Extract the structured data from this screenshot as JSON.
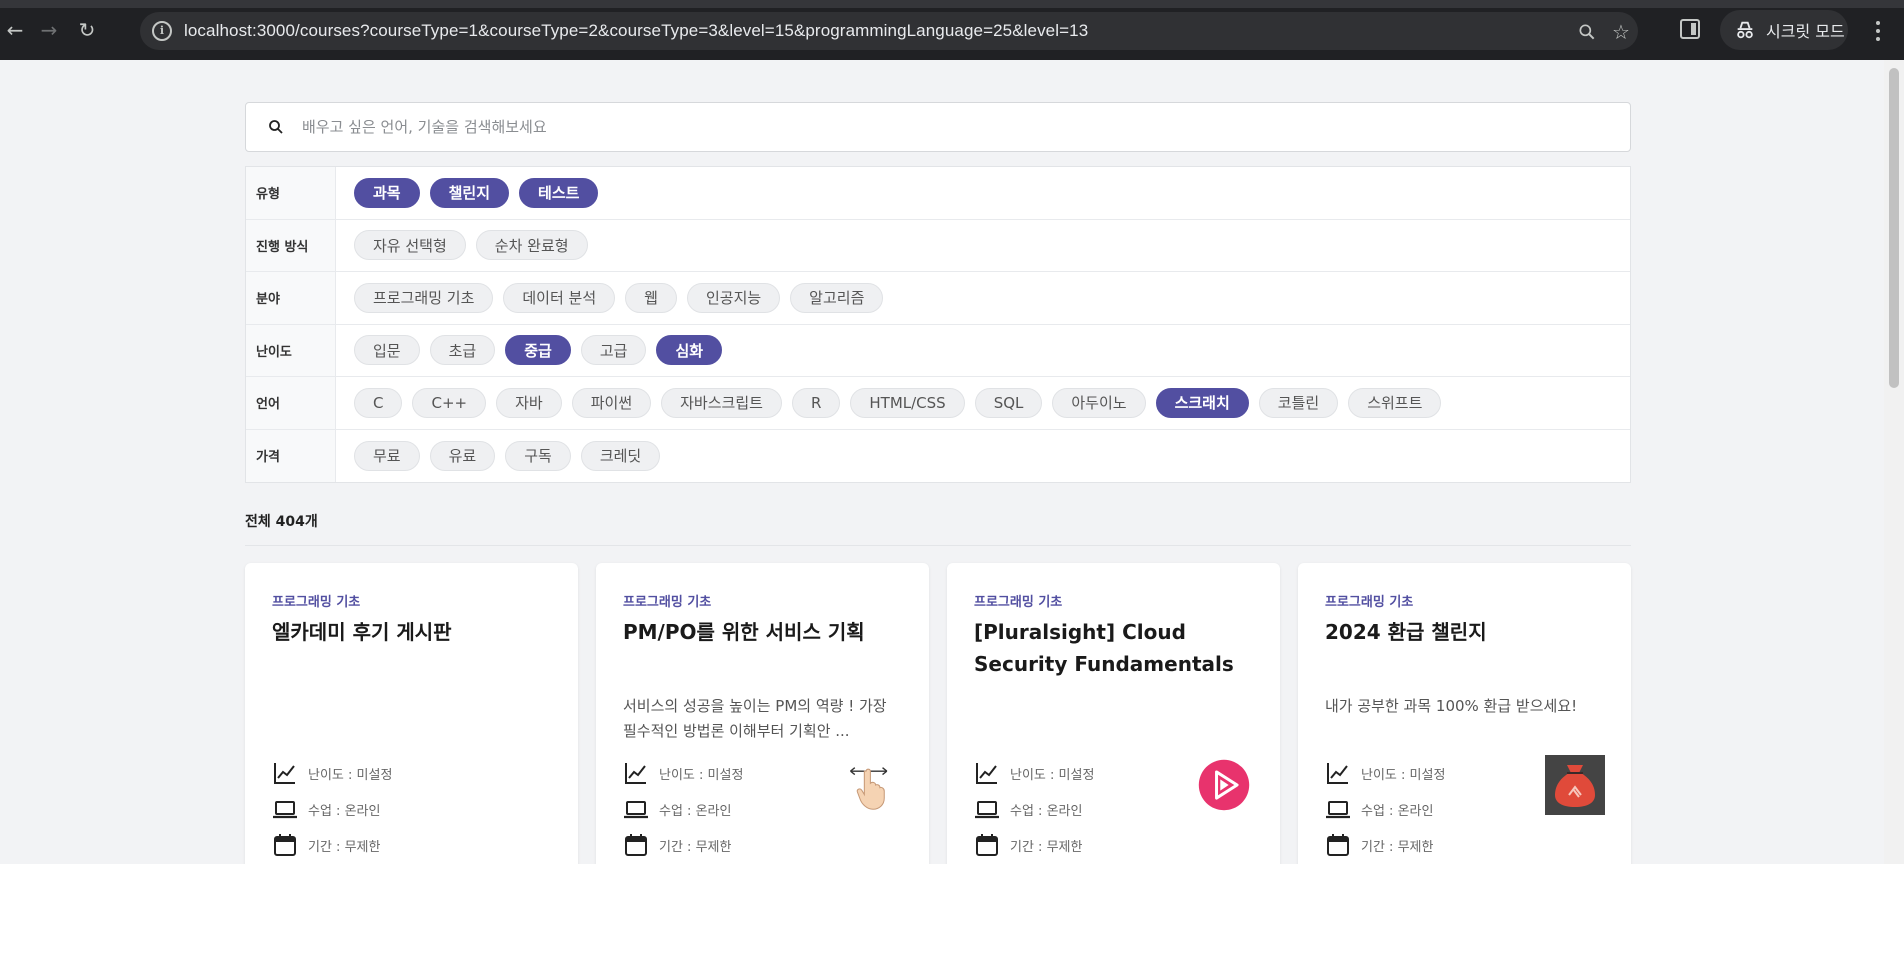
{
  "browser": {
    "url": "localhost:3000/courses?courseType=1&courseType=2&courseType=3&level=15&programmingLanguage=25&level=13",
    "incognito_label": "시크릿 모드"
  },
  "search": {
    "placeholder": "배우고 싶은 언어, 기술을 검색해보세요"
  },
  "filters": [
    {
      "label": "유형",
      "options": [
        {
          "label": "과목",
          "selected": true
        },
        {
          "label": "챌린지",
          "selected": true
        },
        {
          "label": "테스트",
          "selected": true
        }
      ]
    },
    {
      "label": "진행 방식",
      "options": [
        {
          "label": "자유 선택형",
          "selected": false
        },
        {
          "label": "순차 완료형",
          "selected": false
        }
      ]
    },
    {
      "label": "분야",
      "options": [
        {
          "label": "프로그래밍 기초",
          "selected": false
        },
        {
          "label": "데이터 분석",
          "selected": false
        },
        {
          "label": "웹",
          "selected": false
        },
        {
          "label": "인공지능",
          "selected": false
        },
        {
          "label": "알고리즘",
          "selected": false
        }
      ]
    },
    {
      "label": "난이도",
      "options": [
        {
          "label": "입문",
          "selected": false
        },
        {
          "label": "초급",
          "selected": false
        },
        {
          "label": "중급",
          "selected": true
        },
        {
          "label": "고급",
          "selected": false
        },
        {
          "label": "심화",
          "selected": true
        }
      ]
    },
    {
      "label": "언어",
      "options": [
        {
          "label": "C",
          "selected": false
        },
        {
          "label": "C++",
          "selected": false
        },
        {
          "label": "자바",
          "selected": false
        },
        {
          "label": "파이썬",
          "selected": false
        },
        {
          "label": "자바스크립트",
          "selected": false
        },
        {
          "label": "R",
          "selected": false
        },
        {
          "label": "HTML/CSS",
          "selected": false
        },
        {
          "label": "SQL",
          "selected": false
        },
        {
          "label": "아두이노",
          "selected": false
        },
        {
          "label": "스크래치",
          "selected": true
        },
        {
          "label": "코틀린",
          "selected": false
        },
        {
          "label": "스위프트",
          "selected": false
        }
      ]
    },
    {
      "label": "가격",
      "options": [
        {
          "label": "무료",
          "selected": false
        },
        {
          "label": "유료",
          "selected": false
        },
        {
          "label": "구독",
          "selected": false
        },
        {
          "label": "크레딧",
          "selected": false
        }
      ]
    }
  ],
  "total_label": "전체 404개",
  "cards": [
    {
      "category": "프로그래밍 기초",
      "title": "엘카데미 후기 게시판",
      "description": "",
      "level": "난이도 : 미설정",
      "class_type": "수업 : 온라인",
      "period": "기간 : 무제한",
      "thumbnail": "none"
    },
    {
      "category": "프로그래밍 기초",
      "title": "PM/PO를 위한 서비스 기획",
      "description": "서비스의 성공을 높이는 PM의 역량 ! 가장 필수적인 방법론 이해부터 기획안 ...",
      "level": "난이도 : 미설정",
      "class_type": "수업 : 온라인",
      "period": "기간 : 무제한",
      "thumbnail": "pointing-hand-icon"
    },
    {
      "category": "프로그래밍 기초",
      "title": "[Pluralsight] Cloud Security Fundamentals",
      "description": "",
      "level": "난이도 : 미설정",
      "class_type": "수업 : 온라인",
      "period": "기간 : 무제한",
      "thumbnail": "pluralsight-logo"
    },
    {
      "category": "프로그래밍 기초",
      "title": "2024 환급 챌린지",
      "description": "내가 공부한 과목 100% 환급 받으세요!",
      "level": "난이도 : 미설정",
      "class_type": "수업 : 온라인",
      "period": "기간 : 무제한",
      "thumbnail": "money-bag-icon"
    }
  ],
  "colors": {
    "accent": "#524fa1",
    "chrome": "#202124",
    "page_bg": "#f2f3f5",
    "pluralsight": "#e8336d",
    "money_bag_bg": "#444444",
    "money_bag": "#e04a3a"
  }
}
